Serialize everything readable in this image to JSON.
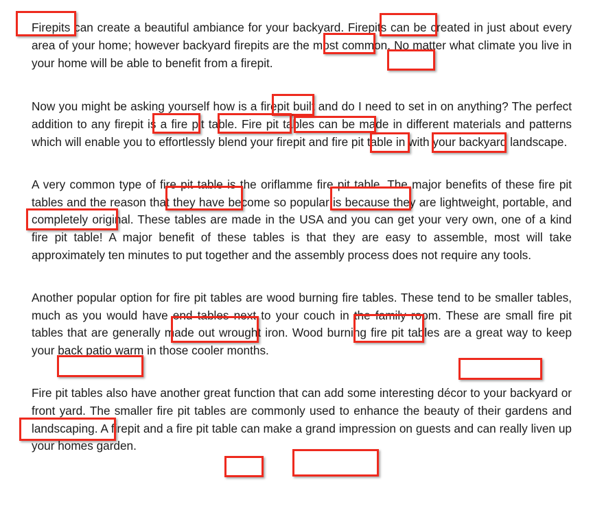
{
  "document": {
    "paragraphs": [
      "Firepits can create a beautiful ambiance for your backyard. Firepits can be created in just about every area of your home; however backyard firepits are the most common. No matter what climate you live in your home will be able to benefit from a firepit.",
      "Now you might be asking yourself how is a firepit built and do I need to set in on anything? The perfect addition to any firepit is a fire pit table. Fire pit tables can be made in different materials and patterns which will enable you to effortlessly blend your firepit and fire pit table in with your backyard landscape.",
      "A very common type of fire pit table is the oriflamme fire pit table. The major benefits of these fire pit tables and the reason that they have become so popular is because they are lightweight, portable, and completely original. These tables are made in the USA and you can get your very own, one of a kind fire pit table! A major benefit of these tables is that they are easy to assemble, most will take approximately ten minutes to put together and the assembly process does not require any tools.",
      "Another popular option for fire pit tables are wood burning fire tables.  These tend to be smaller tables, much as you would have end tables next to your couch in the family room. These are small fire pit tables that are generally made out wrought iron. Wood burning fire pit tables are a great way to keep your back patio warm in those cooler months.",
      "Fire pit tables also have another great function that can add some interesting décor to your backyard or front yard. The smaller fire pit tables are commonly used to enhance the beauty of their gardens and landscaping. A firepit and a fire pit table can make a grand impression on guests and can really liven up your homes garden."
    ],
    "highlighted_keywords": [
      "Firepits",
      "Firepits",
      "firepits",
      "firepit.",
      "firepit",
      "firepit",
      "fire pit table.",
      "Fire pit tables",
      "firepit",
      "fire pit table",
      "fire pit table",
      "fire pit table.",
      "fire pit tables",
      "fire pit tables",
      "fire tables.",
      "fire pit tables",
      "fire pit tables",
      "Fire pit tables",
      "firepit",
      "fire pit table"
    ],
    "highlight_color": "#ee2a1e",
    "text_color": "#1a1a1a"
  }
}
